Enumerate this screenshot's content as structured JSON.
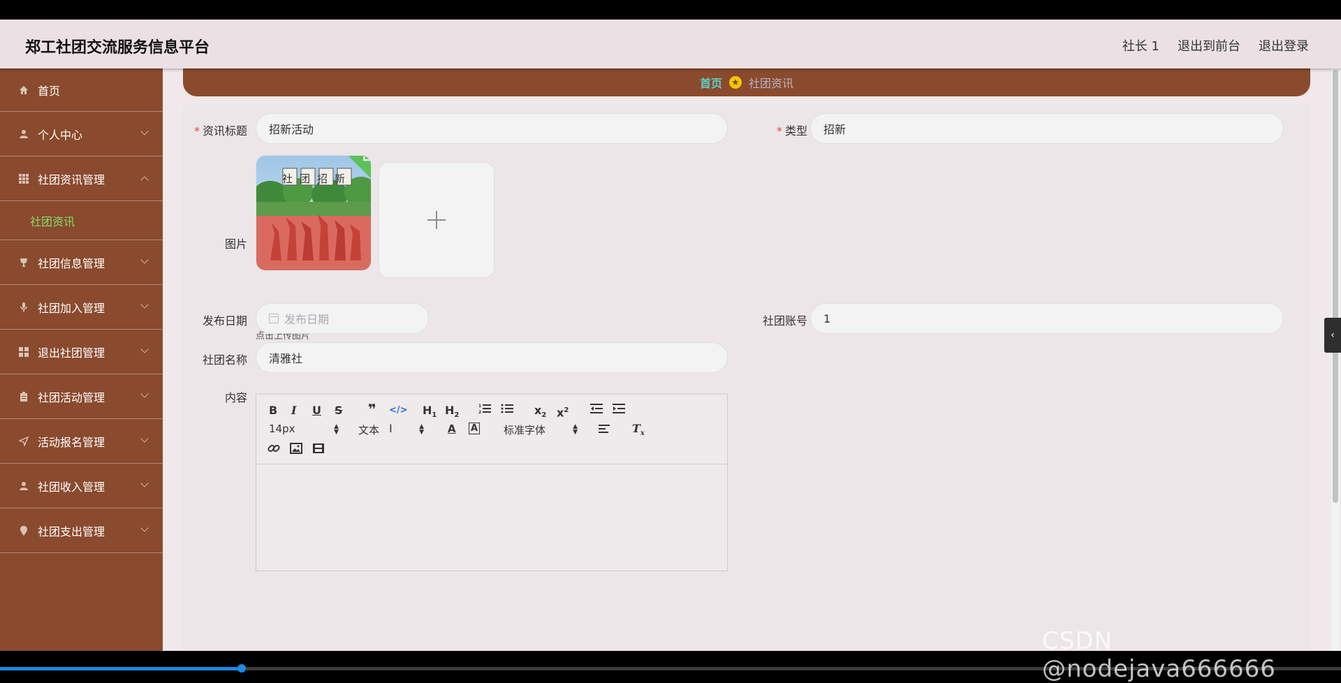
{
  "header": {
    "title": "郑工社团交流服务信息平台",
    "user": "社长 1",
    "to_front": "退出到前台",
    "logout": "退出登录"
  },
  "sidebar": {
    "items": [
      {
        "label": "首页",
        "icon": "home-icon"
      },
      {
        "label": "个人中心",
        "icon": "user-icon"
      },
      {
        "label": "社团资讯管理",
        "icon": "grid-icon",
        "expanded": true,
        "children": [
          "社团资讯"
        ]
      },
      {
        "label": "社团信息管理",
        "icon": "cup-icon"
      },
      {
        "label": "社团加入管理",
        "icon": "mic-icon"
      },
      {
        "label": "退出社团管理",
        "icon": "apps-icon"
      },
      {
        "label": "社团活动管理",
        "icon": "clipboard-icon"
      },
      {
        "label": "活动报名管理",
        "icon": "send-icon"
      },
      {
        "label": "社团收入管理",
        "icon": "user-icon"
      },
      {
        "label": "社团支出管理",
        "icon": "pin-icon"
      }
    ],
    "accent_color": "#7fe06a",
    "bg_color": "#8a4a2d"
  },
  "breadcrumb": {
    "home": "首页",
    "current": "社团资讯"
  },
  "form": {
    "title_label": "资讯标题",
    "title_value": "招新活动",
    "type_label": "类型",
    "type_value": "招新",
    "image_label": "图片",
    "image_caption": "社团招新",
    "upload_hint": "点击上传图片",
    "date_label": "发布日期",
    "date_placeholder": "发布日期",
    "account_label": "社团账号",
    "account_value": "1",
    "club_label": "社团名称",
    "club_value": "清雅社",
    "content_label": "内容"
  },
  "editor": {
    "font_size": "14px",
    "block_type": "文本",
    "font_family": "标准字体"
  },
  "watermark": "CSDN @nodejava666666",
  "video": {
    "progress": 0.18
  }
}
